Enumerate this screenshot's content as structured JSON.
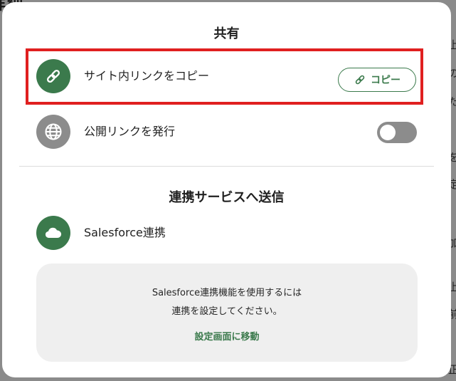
{
  "background": {
    "title": "詳細",
    "right_edge_glyphs": [
      "上",
      "の",
      "た",
      "を",
      "定",
      "加",
      "上",
      "前",
      "正"
    ]
  },
  "colors": {
    "accent_green": "#3b7a4c",
    "icon_grey": "#8c8c8c",
    "highlight_red": "#e02020"
  },
  "share": {
    "title": "共有",
    "internal_link": {
      "icon": "link-icon",
      "label": "サイト内リンクをコピー",
      "copy_button": {
        "icon": "link-icon",
        "label": "コピー"
      }
    },
    "public_link": {
      "icon": "globe-icon",
      "label": "公開リンクを発行",
      "toggle_on": false
    }
  },
  "integrations": {
    "title": "連携サービスへ送信",
    "salesforce": {
      "icon": "cloud-icon",
      "label": "Salesforce連携"
    },
    "info": {
      "line1": "Salesforce連携機能を使用するには",
      "line2": "連携を設定してください。",
      "link_label": "設定画面に移動"
    }
  }
}
